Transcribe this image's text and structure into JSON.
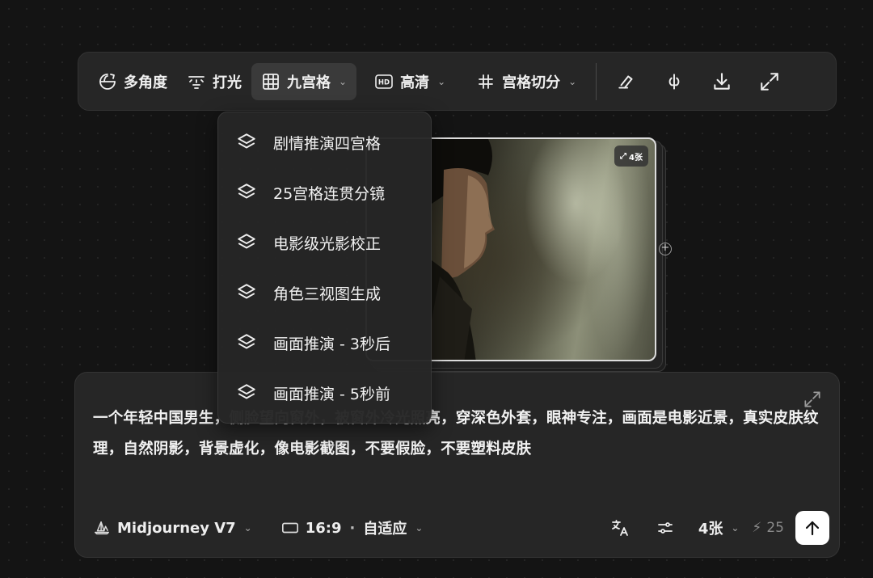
{
  "toolbar": {
    "multi_angle": "多角度",
    "lighting": "打光",
    "grid": "九宫格",
    "hd": "高清",
    "grid_split": "宫格切分",
    "hd_badge": "HD"
  },
  "image": {
    "count_badge": "4张"
  },
  "dropdown": {
    "items": [
      {
        "label": "剧情推演四宫格"
      },
      {
        "label": "25宫格连贯分镜"
      },
      {
        "label": "电影级光影校正"
      },
      {
        "label": "角色三视图生成"
      },
      {
        "label": "画面推演 - 3秒后"
      },
      {
        "label": "画面推演 - 5秒前"
      }
    ]
  },
  "prompt": {
    "text": "一个年轻中国男生，侧脸望向窗外，被窗外冷光照亮，穿深色外套，眼神专注，画面是电影近景，真实皮肤纹理，自然阴影，背景虚化，像电影截图，不要假脸，不要塑料皮肤"
  },
  "bottom": {
    "model": "Midjourney V7",
    "ratio": "16:9",
    "adapt": "自适应",
    "separator": "·",
    "count": "4张",
    "credits": "25"
  },
  "colors": {
    "background": "#141414",
    "panel": "#262626",
    "active": "#3a3a3a",
    "send_button": "#ffffff"
  }
}
